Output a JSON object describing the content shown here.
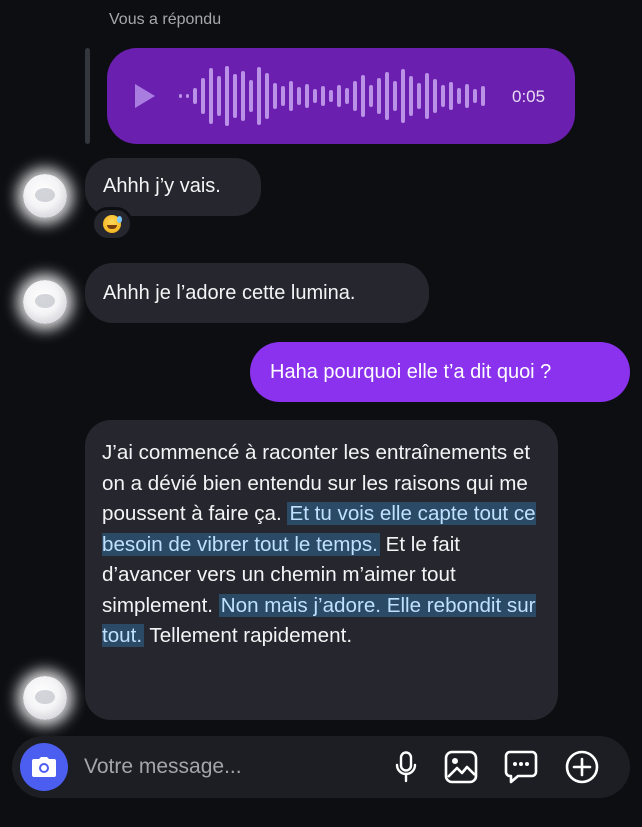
{
  "reply_context": {
    "label": "Vous a répondu",
    "voice_message": {
      "duration": "0:05",
      "play_icon": "play-icon"
    }
  },
  "messages": [
    {
      "side": "incoming",
      "text": "Ahhh j’y vais.",
      "reaction_icon": "sweat-smile-emoji"
    },
    {
      "side": "incoming",
      "text": "Ahhh je l’adore cette lumina."
    },
    {
      "side": "outgoing",
      "text": "Haha pourquoi elle t’a dit quoi ?"
    },
    {
      "side": "incoming",
      "segments": [
        {
          "text": "J’ai commencé à raconter les entraînements et on a dévié bien entendu sur les raisons qui me poussent à faire ça. ",
          "highlighted": false
        },
        {
          "text": "Et tu vois elle capte tout ce besoin de vibrer tout le temps.",
          "highlighted": true
        },
        {
          "text": " Et le fait d’avancer vers un chemin m’aimer tout simplement. ",
          "highlighted": false
        },
        {
          "text": "Non mais j’adore. Elle rebondit sur tout.",
          "highlighted": true
        },
        {
          "text": " Tellement rapidement.",
          "highlighted": false
        }
      ]
    }
  ],
  "composer": {
    "placeholder": "Votre message...",
    "value": "",
    "icons": [
      "camera-icon",
      "microphone-icon",
      "gallery-icon",
      "sticker-chat-icon",
      "add-plus-icon"
    ]
  },
  "colors": {
    "background": "#0d0e12",
    "incoming_bubble": "#26272e",
    "outgoing_bubble": "#8a32ee",
    "voice_bubble": "#6b1fae",
    "highlight": "#2a4a66",
    "camera_button": "#4b5ef0"
  }
}
